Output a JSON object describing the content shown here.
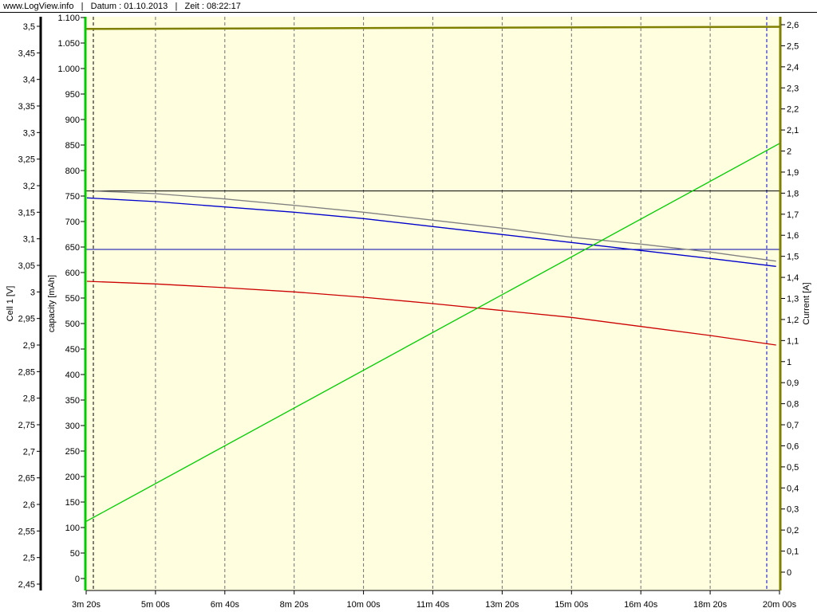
{
  "header": {
    "site": "www.LogView.info",
    "sep1": "   |   ",
    "date_label": "Datum : 01.10.2013",
    "sep2": "   |   ",
    "time_label": "Zeit : 08:22:17"
  },
  "chart_data": {
    "type": "line",
    "x_ticks": [
      "3m 20s",
      "5m 00s",
      "6m 40s",
      "8m 20s",
      "10m 00s",
      "11m 40s",
      "13m 20s",
      "15m 00s",
      "16m 40s",
      "18m 20s",
      "20m 00s"
    ],
    "x_range_seconds": [
      200,
      1200
    ],
    "axes": {
      "voltage": {
        "label": "Cell 1 [V]",
        "ticks": [
          "2,45",
          "2,5",
          "2,55",
          "2,6",
          "2,65",
          "2,7",
          "2,75",
          "2,8",
          "2,85",
          "2,9",
          "2,95",
          "3",
          "3,05",
          "3,1",
          "3,15",
          "3,2",
          "3,25",
          "3,3",
          "3,35",
          "3,4",
          "3,45",
          "3,5"
        ],
        "range": [
          2.45,
          3.5
        ],
        "color": "#000000"
      },
      "capacity": {
        "label": "capacity [mAh]",
        "ticks": [
          "0",
          "50",
          "100",
          "150",
          "200",
          "250",
          "300",
          "350",
          "400",
          "450",
          "500",
          "550",
          "600",
          "650",
          "700",
          "750",
          "800",
          "850",
          "900",
          "950",
          "1.000",
          "1.050",
          "1.100"
        ],
        "range": [
          0,
          1100
        ],
        "color": "#00cc00"
      },
      "current": {
        "label": "Current [A]",
        "ticks": [
          "0",
          "0,1",
          "0,2",
          "0,3",
          "0,4",
          "0,5",
          "0,6",
          "0,7",
          "0,8",
          "0,9",
          "1",
          "1,1",
          "1,2",
          "1,3",
          "1,4",
          "1,5",
          "1,6",
          "1,7",
          "1,8",
          "1,9",
          "2",
          "2,1",
          "2,2",
          "2,3",
          "2,4",
          "2,5",
          "2,6"
        ],
        "range": [
          0,
          2.6
        ],
        "color": "#808000"
      }
    },
    "series": [
      {
        "color": "#808080",
        "axis": "voltage",
        "x": [
          211,
          300,
          400,
          500,
          600,
          700,
          800,
          900,
          1000,
          1100,
          1195
        ],
        "y": [
          3.19,
          3.185,
          3.175,
          3.163,
          3.15,
          3.135,
          3.12,
          3.103,
          3.09,
          3.075,
          3.058
        ]
      },
      {
        "color": "#0000cc",
        "axis": "voltage",
        "x": [
          201,
          300,
          400,
          500,
          600,
          700,
          800,
          900,
          1000,
          1100,
          1195
        ],
        "y": [
          3.177,
          3.17,
          3.16,
          3.15,
          3.138,
          3.123,
          3.108,
          3.093,
          3.078,
          3.063,
          3.048
        ]
      },
      {
        "color": "#cc0000",
        "axis": "voltage",
        "x": [
          201,
          300,
          400,
          500,
          600,
          700,
          800,
          900,
          1000,
          1100,
          1195
        ],
        "y": [
          3.02,
          3.015,
          3.008,
          3.0,
          2.99,
          2.978,
          2.965,
          2.952,
          2.935,
          2.918,
          2.9
        ]
      },
      {
        "color": "#00cc00",
        "axis": "capacity",
        "x": [
          200,
          1200
        ],
        "y": [
          112,
          853
        ]
      },
      {
        "color": "#808000",
        "axis": "current",
        "x": [
          200,
          1200
        ],
        "y": [
          2.58,
          2.59
        ]
      }
    ],
    "reference_lines": [
      {
        "axis": "voltage",
        "value": 3.19,
        "color": "#000000"
      },
      {
        "axis": "voltage",
        "value": 3.08,
        "color": "#0000aa"
      }
    ],
    "grid": true,
    "plot_background": "#ffffe0"
  }
}
